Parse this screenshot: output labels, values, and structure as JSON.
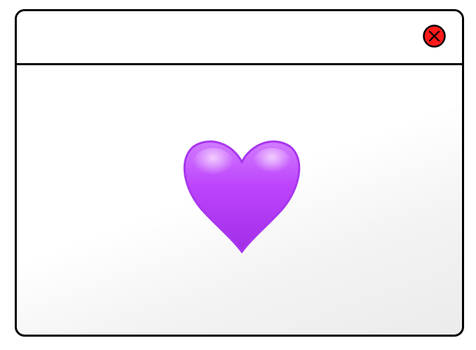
{
  "window": {
    "close_icon": "close-circle-x-icon",
    "close_color": "#ff0000"
  },
  "content": {
    "emoji": "purple-heart",
    "emoji_color": "#b93ef5"
  }
}
